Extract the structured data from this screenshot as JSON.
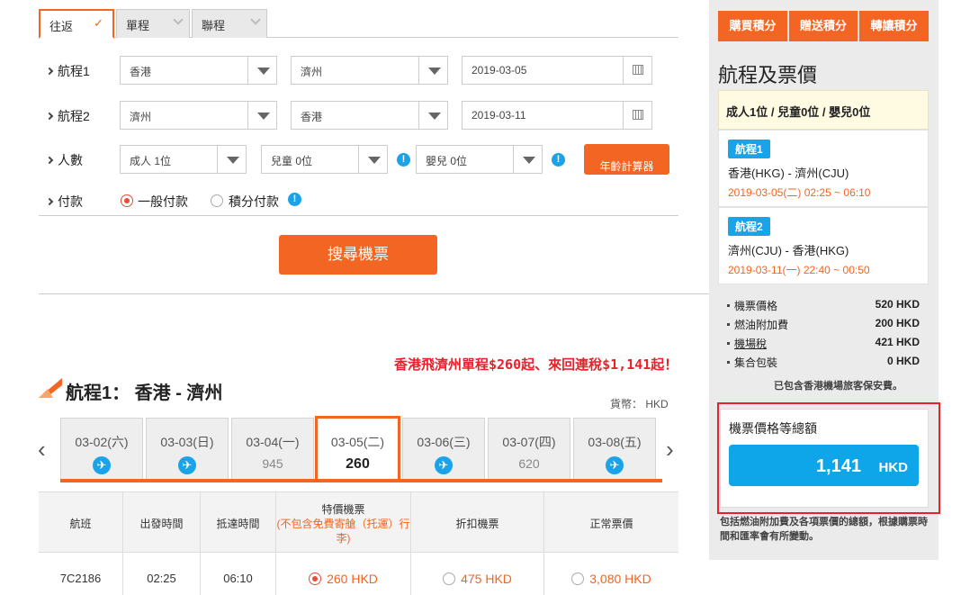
{
  "trip_tabs": [
    {
      "label": "往返",
      "active": true
    },
    {
      "label": "單程",
      "active": false
    },
    {
      "label": "聯程",
      "active": false
    }
  ],
  "leg1": {
    "label": "航程1",
    "from": "香港",
    "to": "濟州",
    "date": "2019-03-05"
  },
  "leg2": {
    "label": "航程2",
    "from": "濟州",
    "to": "香港",
    "date": "2019-03-11"
  },
  "passengers": {
    "label": "人數",
    "adult": "成人 1位",
    "child": "兒童 0位",
    "infant": "嬰兒 0位",
    "age_calc": "年齡計算器"
  },
  "payment": {
    "label": "付款",
    "option1": "一般付款",
    "option2": "積分付款"
  },
  "search_button": "搜尋機票",
  "promo": "香港飛濟州單程$260起、來回連稅$1,141起！",
  "flight_section": {
    "title": "航程1： 香港 - 濟州",
    "currency": "貨幣： HKD"
  },
  "dates": [
    {
      "date": "03-02(六)",
      "price": "",
      "plane": true
    },
    {
      "date": "03-03(日)",
      "price": "",
      "plane": true
    },
    {
      "date": "03-04(一)",
      "price": "945",
      "plane": false
    },
    {
      "date": "03-05(二)",
      "price": "260",
      "plane": false,
      "active": true
    },
    {
      "date": "03-06(三)",
      "price": "",
      "plane": true
    },
    {
      "date": "03-07(四)",
      "price": "620",
      "plane": false
    },
    {
      "date": "03-08(五)",
      "price": "",
      "plane": true
    }
  ],
  "table": {
    "headers": {
      "flight": "航班",
      "depart": "出發時間",
      "arrive": "抵達時間",
      "special": "特價機票",
      "special_sub": "(不包含免費寄艙（托運）行李)",
      "discount": "折扣機票",
      "regular": "正常票價"
    },
    "row": {
      "flight": "7C2186",
      "depart": "02:25",
      "arrive": "06:10",
      "special": "260 HKD",
      "discount": "475 HKD",
      "regular": "3,080 HKD"
    }
  },
  "right_panel": {
    "points_buttons": [
      "購買積分",
      "贈送積分",
      "轉讓積分"
    ],
    "title": "航程及票價",
    "pax_summary": "成人1位 / 兒童0位 / 嬰兒0位",
    "legs": [
      {
        "badge": "航程1",
        "route": "香港(HKG) - 濟州(CJU)",
        "time": "2019-03-05(二) 02:25 ~ 06:10"
      },
      {
        "badge": "航程2",
        "route": "濟州(CJU) - 香港(HKG)",
        "time": "2019-03-11(一) 22:40 ~ 00:50"
      }
    ],
    "fares": [
      {
        "label": "機票價格",
        "value": "520 HKD"
      },
      {
        "label": "燃油附加費",
        "value": "200 HKD"
      },
      {
        "label": "機場稅",
        "value": "421 HKD"
      },
      {
        "label": "集合包裝",
        "value": "0 HKD"
      }
    ],
    "fare_note": "已包含香港機場旅客保安費。",
    "total_label": "機票價格等總額",
    "total_amount": "1,141",
    "total_currency": "HKD",
    "bottom_note": "包括燃油附加費及各項票價的總額，根據購票時間和匯率會有所變動。"
  }
}
